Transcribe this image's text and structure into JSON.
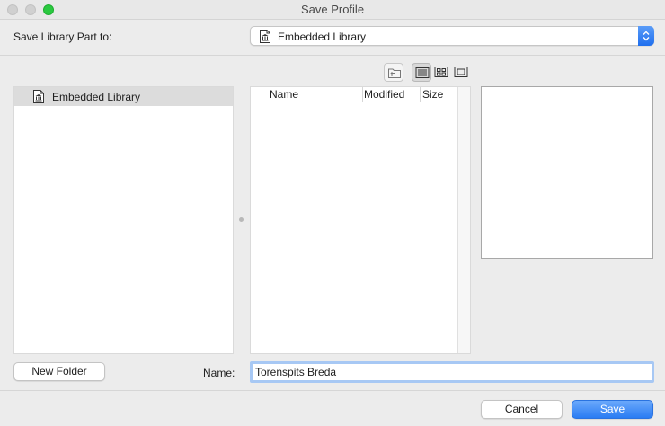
{
  "window": {
    "title": "Save Profile"
  },
  "top": {
    "save_to_label": "Save Library Part to:",
    "destination": "Embedded Library"
  },
  "tree": {
    "items": [
      {
        "label": "Embedded Library",
        "selected": true
      }
    ]
  },
  "file_list": {
    "columns": [
      "Name",
      "Modified",
      "Size"
    ],
    "rows": []
  },
  "bottom": {
    "new_folder_label": "New Folder",
    "name_label": "Name:",
    "name_value": "Torenspits Breda",
    "cancel_label": "Cancel",
    "save_label": "Save"
  },
  "icons": {
    "view_up": "folder-up-icon",
    "view_list": "list-view-icon",
    "view_icons": "icon-view-icon",
    "view_preview": "preview-view-icon",
    "library": "library-doc-icon"
  },
  "colors": {
    "accent": "#2a7cf3",
    "close": "#d0d0d0",
    "maximize": "#2ac940"
  }
}
